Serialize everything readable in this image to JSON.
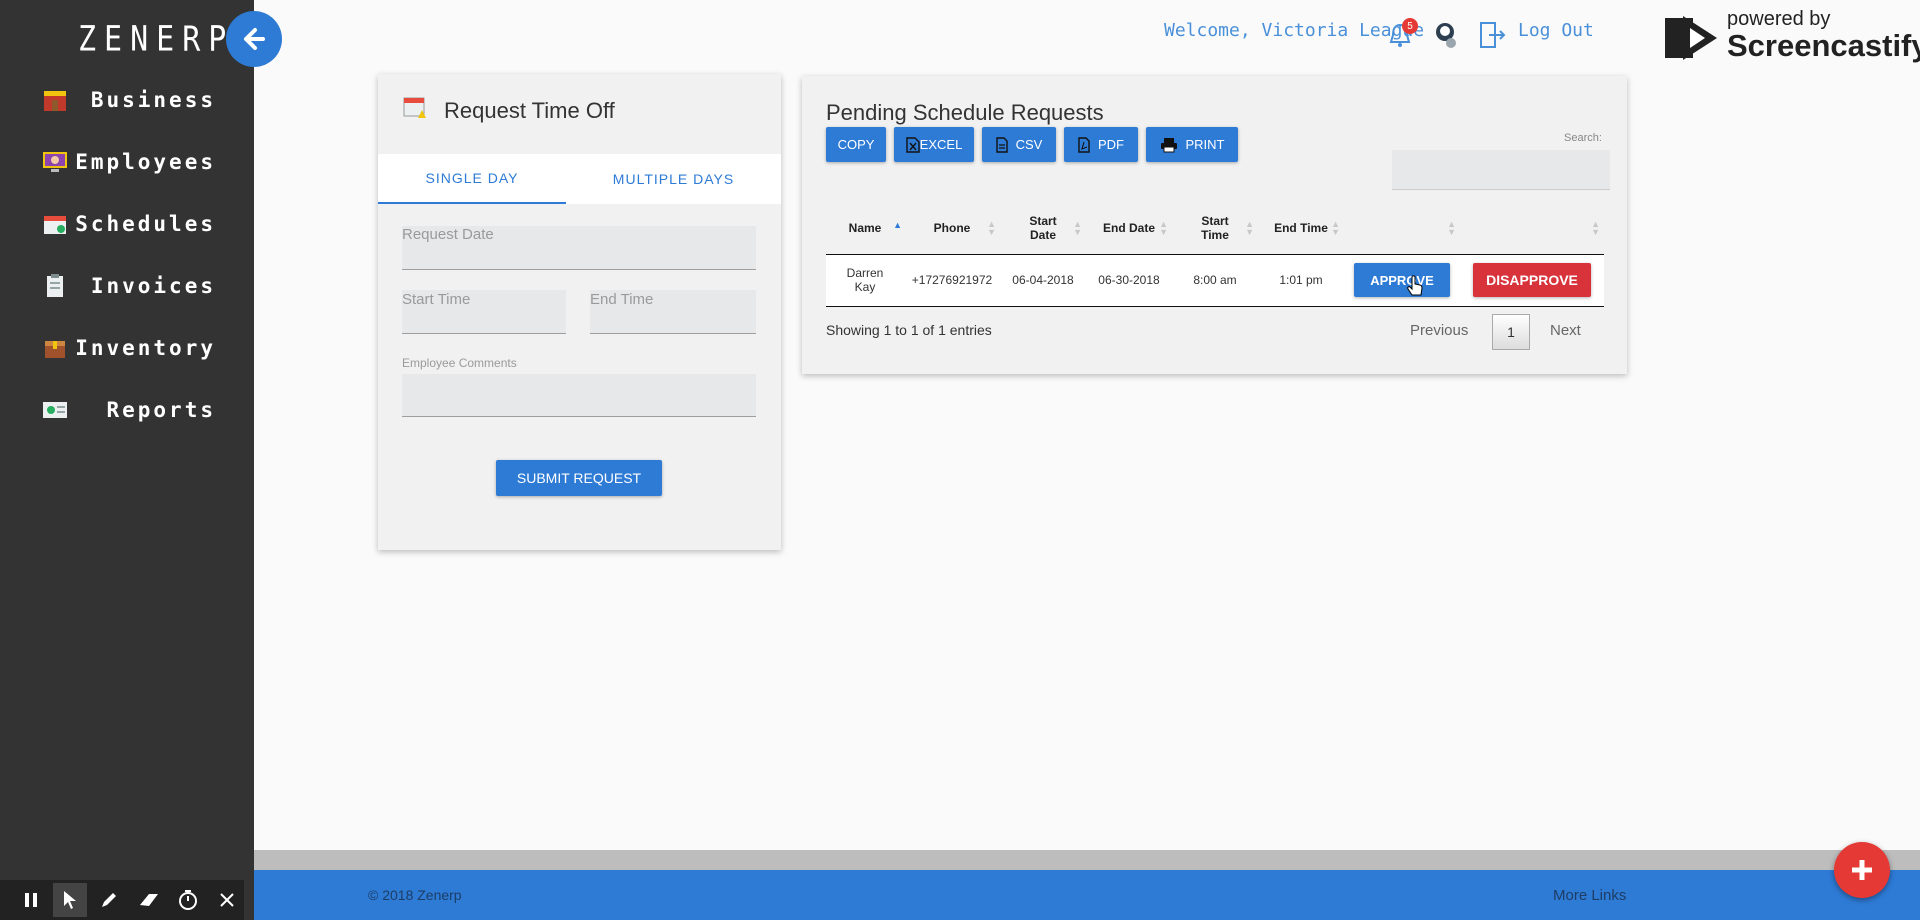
{
  "app": {
    "logo": "ZENERP"
  },
  "sidebar": {
    "items": [
      {
        "label": "Business",
        "icon": "store-icon"
      },
      {
        "label": "Employees",
        "icon": "monitor-user-icon"
      },
      {
        "label": "Schedules",
        "icon": "calendar-icon"
      },
      {
        "label": "Invoices",
        "icon": "clipboard-icon"
      },
      {
        "label": "Inventory",
        "icon": "box-icon"
      },
      {
        "label": "Reports",
        "icon": "report-icon"
      }
    ]
  },
  "header": {
    "welcome": "Welcome, Victoria League",
    "notification_count": "5",
    "logout": "Log Out",
    "watermark_top": "powered by",
    "watermark_brand": "Screencastify"
  },
  "request_form": {
    "title": "Request Time Off",
    "tabs": [
      "SINGLE DAY",
      "MULTIPLE DAYS"
    ],
    "active_tab": "SINGLE DAY",
    "request_date_label": "Request Date",
    "start_time_label": "Start Time",
    "end_time_label": "End Time",
    "comments_label": "Employee Comments",
    "submit_label": "SUBMIT REQUEST"
  },
  "pending": {
    "title": "Pending Schedule Requests",
    "export_buttons": [
      "COPY",
      "EXCEL",
      "CSV",
      "PDF",
      "PRINT"
    ],
    "search_label": "Search:",
    "columns": [
      "Name",
      "Phone",
      "Start Date",
      "End Date",
      "Start Time",
      "End Time"
    ],
    "rows": [
      {
        "name": "Darren Kay",
        "phone": "+17276921972",
        "start_date": "06-04-2018",
        "end_date": "06-30-2018",
        "start_time": "8:00 am",
        "end_time": "1:01 pm",
        "approve": "APPROVE",
        "disapprove": "DISAPPROVE"
      }
    ],
    "info": "Showing 1 to 1 of 1 entries",
    "pagination": {
      "previous": "Previous",
      "page": "1",
      "next": "Next"
    }
  },
  "footer": {
    "copyright": "© 2018 Zenerp",
    "more_links": "More Links"
  },
  "colors": {
    "primary": "#2e7bd6",
    "danger": "#d8323a",
    "sidebar": "#333333"
  }
}
